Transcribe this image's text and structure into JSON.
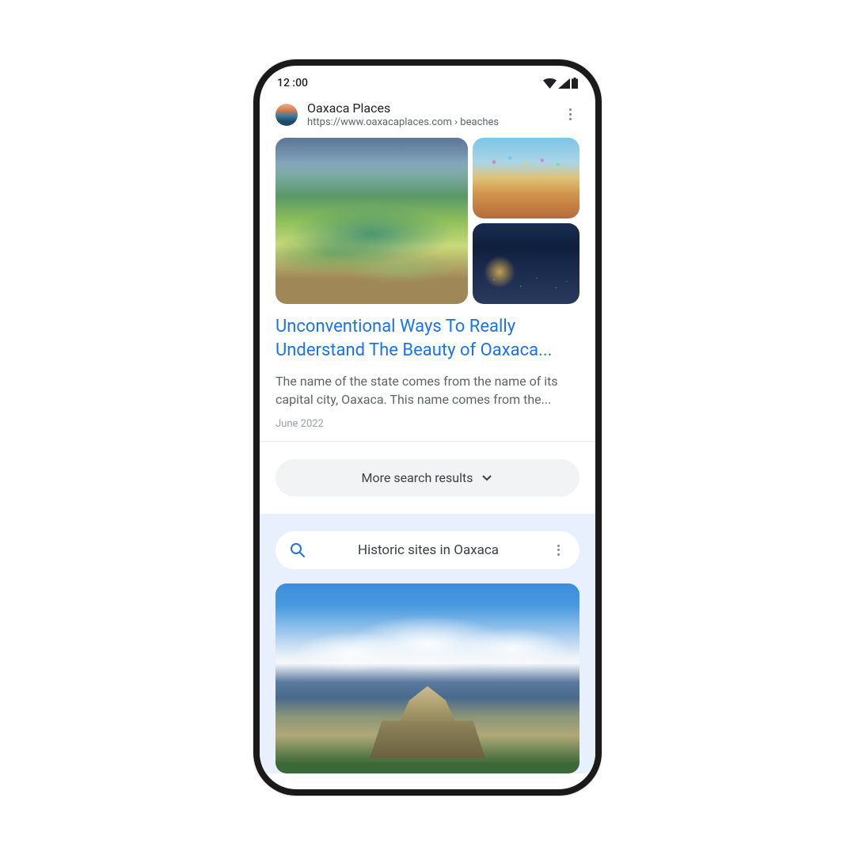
{
  "status_bar": {
    "time": "12 :00"
  },
  "result": {
    "site_name": "Oaxaca Places",
    "site_url": "https://www.oaxacaplaces.com",
    "site_path": " › beaches",
    "title": "Unconventional Ways To Really Understand The Beauty of Oaxaca...",
    "snippet": "The name of the state comes from the name of its capital city, Oaxaca. This name comes from the...",
    "date": "June 2022"
  },
  "more_results_label": "More search results",
  "related": {
    "query": "Historic sites in Oaxaca"
  },
  "colors": {
    "link": "#1a73e8",
    "text_secondary": "#5f6368",
    "related_bg": "#e8f0fe"
  }
}
